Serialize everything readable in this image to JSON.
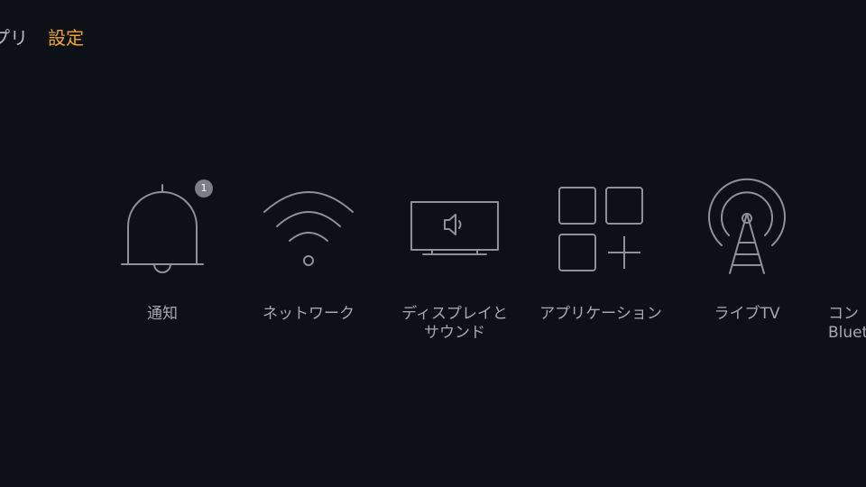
{
  "topnav": {
    "apps_label": "アプリ",
    "settings_label": "設定"
  },
  "colors": {
    "background": "#0c1117",
    "accent": "#f2a62a",
    "icon_stroke": "#8f9295",
    "label": "#a6a9ad"
  },
  "tiles": [
    {
      "label": "通知",
      "icon": "bell-icon",
      "badge": "1"
    },
    {
      "label": "ネットワーク",
      "icon": "wifi-icon"
    },
    {
      "label": "ディスプレイと\nサウンド",
      "icon": "tv-speaker-icon"
    },
    {
      "label": "アプリケーション",
      "icon": "apps-grid-icon"
    },
    {
      "label": "ライブTV",
      "icon": "antenna-icon"
    },
    {
      "label": "コン\nBluet",
      "icon": "controller-icon"
    }
  ]
}
